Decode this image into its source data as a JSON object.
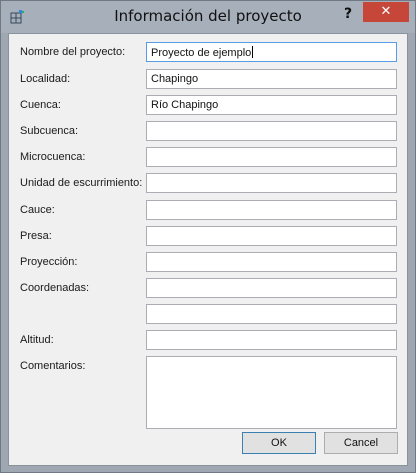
{
  "window": {
    "title": "Información del proyecto",
    "help_label": "?",
    "close_label": "✕"
  },
  "form": {
    "labels": {
      "nombre": "Nombre del proyecto:",
      "localidad": "Localidad:",
      "cuenca": "Cuenca:",
      "subcuenca": "Subcuenca:",
      "microcuenca": "Microcuenca:",
      "unidad": "Unidad de escurrimiento:",
      "cauce": "Cauce:",
      "presa": "Presa:",
      "proyeccion": "Proyección:",
      "coordenadas": "Coordenadas:",
      "altitud": "Altitud:",
      "comentarios": "Comentarios:"
    },
    "values": {
      "nombre": "Proyecto de ejemplo",
      "localidad": "Chapingo",
      "cuenca": "Río Chapingo",
      "subcuenca": "",
      "microcuenca": "",
      "unidad": "",
      "cauce": "",
      "presa": "",
      "proyeccion": "",
      "coordenadas_1": "",
      "coordenadas_2": "",
      "altitud": "",
      "comentarios": ""
    }
  },
  "buttons": {
    "ok": "OK",
    "cancel": "Cancel"
  },
  "icons": {
    "app": "project-info-icon",
    "close": "close-icon"
  }
}
